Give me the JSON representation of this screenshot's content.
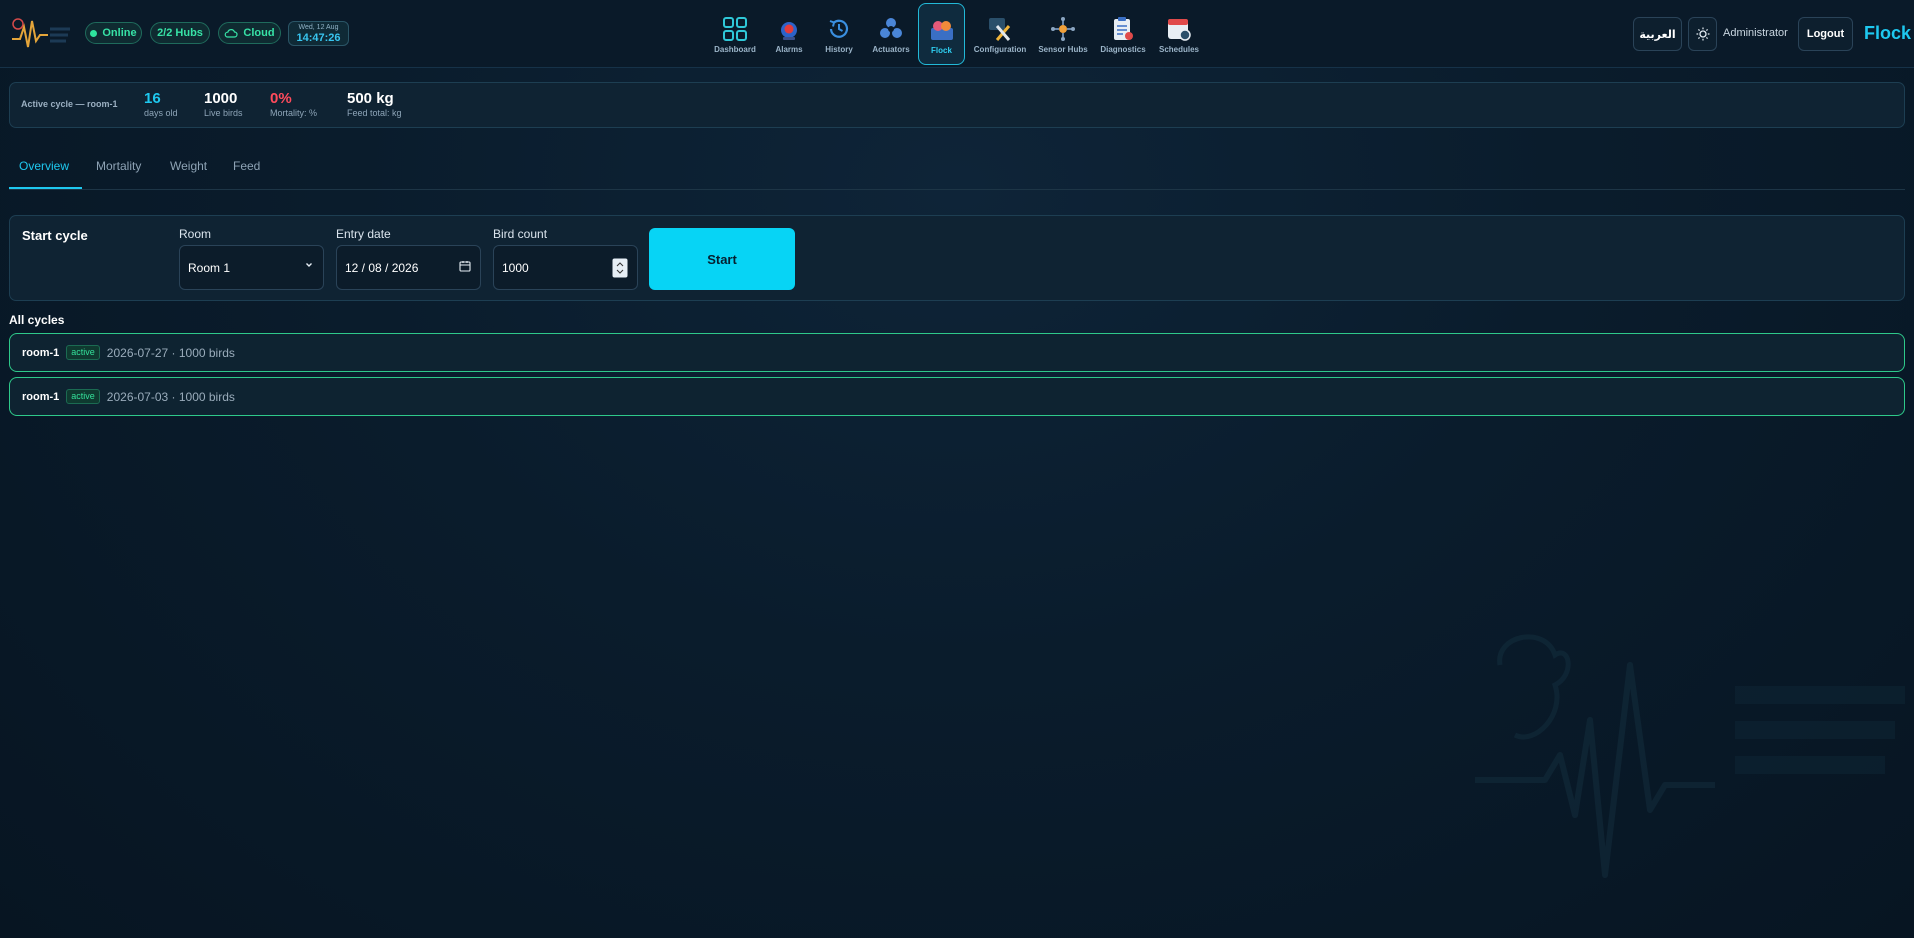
{
  "header": {
    "status_online": "Online",
    "hubs": "2/2 Hubs",
    "cloud": "Cloud",
    "date": "Wed, 12 Aug",
    "time": "14:47:26",
    "nav": [
      {
        "label": "Dashboard",
        "icon": "dashboard-icon"
      },
      {
        "label": "Alarms",
        "icon": "alarm-icon"
      },
      {
        "label": "History",
        "icon": "history-icon"
      },
      {
        "label": "Actuators",
        "icon": "fan-icon"
      },
      {
        "label": "Flock",
        "icon": "flock-icon",
        "active": true
      },
      {
        "label": "Configuration",
        "icon": "tools-icon"
      },
      {
        "label": "Sensor Hubs",
        "icon": "hub-icon"
      },
      {
        "label": "Diagnostics",
        "icon": "clipboard-icon"
      },
      {
        "label": "Schedules",
        "icon": "calendar-icon"
      }
    ],
    "language": "العربية",
    "user": "Administrator",
    "logout": "Logout",
    "page_title": "Flock"
  },
  "active_cycle": {
    "label": "Active cycle — room-1",
    "stats": [
      {
        "value": "16",
        "label": "days old",
        "color": "#1ec8ef"
      },
      {
        "value": "1000",
        "label": "Live birds",
        "color": "#ffffff"
      },
      {
        "value": "0%",
        "label": "Mortality: %",
        "color": "#ff4b5c"
      },
      {
        "value": "500 kg",
        "label": "Feed total: kg",
        "color": "#ffffff"
      }
    ]
  },
  "tabs": [
    "Overview",
    "Mortality",
    "Weight",
    "Feed"
  ],
  "start_cycle": {
    "title": "Start cycle",
    "room_label": "Room",
    "room_value": "Room 1",
    "entry_label": "Entry date",
    "entry_value": "12 / 08 / 2026",
    "count_label": "Bird count",
    "count_value": "1000",
    "start_button": "Start"
  },
  "all_cycles": {
    "title": "All cycles",
    "rows": [
      {
        "room": "room-1",
        "status": "active",
        "meta": "2026-07-27 · 1000 birds"
      },
      {
        "room": "room-1",
        "status": "active",
        "meta": "2026-07-03 · 1000 birds"
      }
    ]
  },
  "colors": {
    "accent": "#1ec8ef",
    "success": "#2ee59d",
    "danger": "#ff4b5c",
    "background": "#0a1c2c"
  }
}
